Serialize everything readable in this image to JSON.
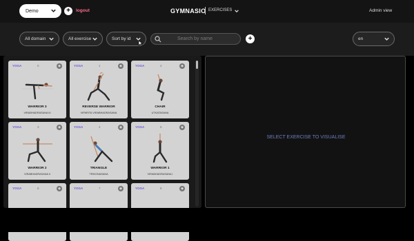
{
  "topbar": {
    "demo_select": "Demo",
    "logout": "logout",
    "brand": "GYMNASIO",
    "section": "EXERCISES",
    "admin": "Admin view"
  },
  "filters": {
    "domain": "All domain",
    "exercise": "All exercise",
    "sort": "Sort by id",
    "search_placeholder": "Search by name",
    "language": "en"
  },
  "exercises": [
    {
      "tag": "YOGA",
      "id": "0",
      "name": "WARRIOR 3",
      "sanskrit": "VIRABHADRASANA III"
    },
    {
      "tag": "YOGA",
      "id": "1",
      "name": "REVERSE WARRIOR",
      "sanskrit": "VIPARITA VIRABHADRASANA"
    },
    {
      "tag": "YOGA",
      "id": "2",
      "name": "CHAIR",
      "sanskrit": "UTKATASANA"
    },
    {
      "tag": "YOGA",
      "id": "3",
      "name": "WARRIOR 2",
      "sanskrit": "VIRABHADRASANA II"
    },
    {
      "tag": "YOGA",
      "id": "4",
      "name": "TRIANGLE",
      "sanskrit": "TRIKONASANA"
    },
    {
      "tag": "YOGA",
      "id": "5",
      "name": "WARRIOR 1",
      "sanskrit": "VIRABHADRASANA I"
    },
    {
      "tag": "YOGA",
      "id": "6",
      "name": "",
      "sanskrit": ""
    },
    {
      "tag": "YOGA",
      "id": "7",
      "name": "",
      "sanskrit": ""
    },
    {
      "tag": "YOGA",
      "id": "8",
      "name": "",
      "sanskrit": ""
    }
  ],
  "detail": {
    "placeholder": "SELECT EXERCISE TO VISUALISE"
  },
  "colors": {
    "accent_tag": "#6b5bd9",
    "logout": "#ff6b8a",
    "placeholder_text": "#6d7fbf"
  }
}
